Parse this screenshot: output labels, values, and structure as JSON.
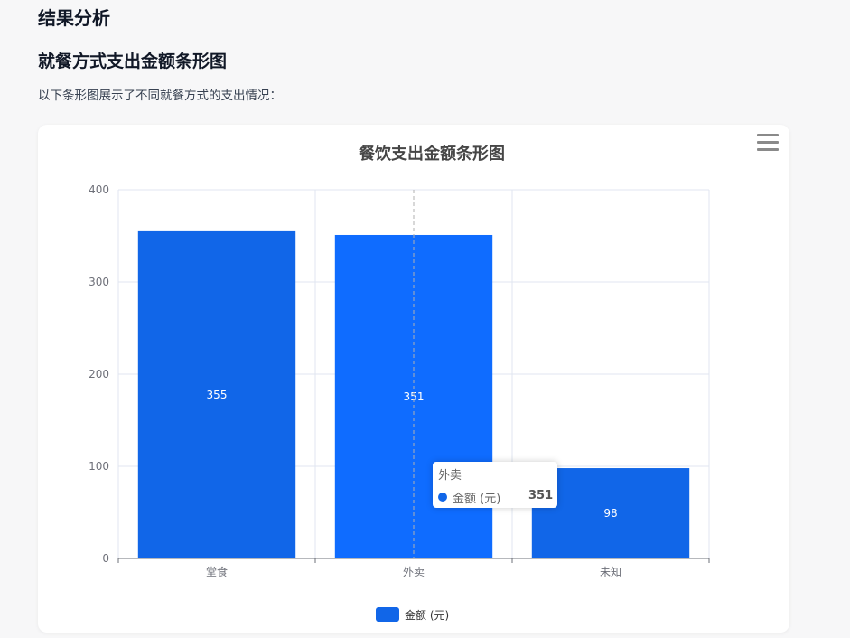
{
  "page": {
    "heading": "结果分析",
    "subheading": "就餐方式支出金额条形图",
    "description": "以下条形图展示了不同就餐方式的支出情况："
  },
  "chart_data": {
    "type": "bar",
    "title": "餐饮支出金额条形图",
    "categories": [
      "堂食",
      "外卖",
      "未知"
    ],
    "series": [
      {
        "name": "金额 (元)",
        "values": [
          355,
          351,
          98
        ]
      }
    ],
    "ylim": [
      0,
      400
    ],
    "yticks": [
      0,
      100,
      200,
      300,
      400
    ],
    "xlabel": "",
    "ylabel": "",
    "grid": true,
    "legend": "bottom-center",
    "colors": {
      "bar": "#1166e8",
      "bar_highlight": "#0f6cff"
    }
  },
  "tooltip": {
    "title": "外卖",
    "series_name": "金额 (元)",
    "value": "351"
  },
  "icons": {
    "menu": "hamburger-menu-icon"
  }
}
